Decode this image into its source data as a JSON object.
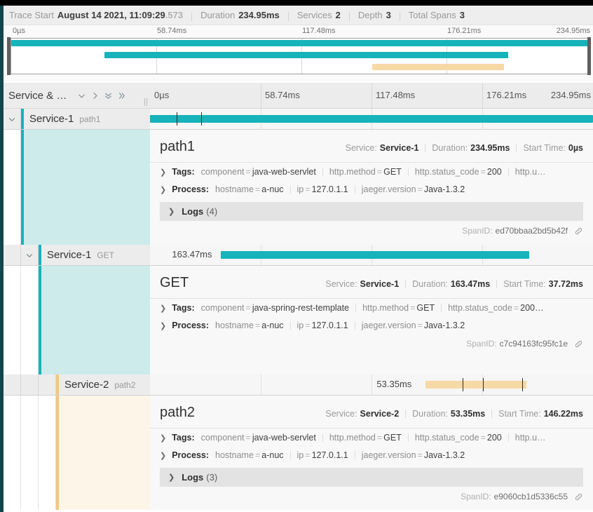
{
  "header": {
    "trace_start_label": "Trace Start",
    "trace_start_value": "August 14 2021, 11:09:29",
    "trace_start_ms": ".573",
    "duration_label": "Duration",
    "duration_value": "234.95ms",
    "services_label": "Services",
    "services_value": "2",
    "depth_label": "Depth",
    "depth_value": "3",
    "total_spans_label": "Total Spans",
    "total_spans_value": "3"
  },
  "minimap": {
    "ticks": [
      "0µs",
      "58.74ms",
      "117.48ms",
      "176.21ms",
      "234.95ms"
    ]
  },
  "timeline_header": {
    "column_title": "Service & …",
    "ticks": [
      "0µs",
      "58.74ms",
      "117.48ms",
      "176.21ms",
      "234.95ms"
    ],
    "icons": [
      "chevron-down-icon",
      "chevron-right-icon",
      "chevrons-down-icon",
      "chevrons-right-icon"
    ]
  },
  "colors": {
    "teal": "#17b3ba",
    "teal_dark": "#12464c",
    "orange": "#f7d9a6",
    "orange_accent": "#f3c77e",
    "tint_teal": "#cdebeb",
    "tint_orange": "#fdf5e7"
  },
  "spans": [
    {
      "service": "Service-1",
      "operation": "path1",
      "depth": 0,
      "color": "teal",
      "bar_label": "",
      "bar_start_pct": 0.0,
      "bar_width_pct": 100.0,
      "bar_ticks_pct": [
        6.0,
        11.5
      ],
      "detail": {
        "title": "path1",
        "service_label": "Service:",
        "service_value": "Service-1",
        "duration_label": "Duration:",
        "duration_value": "234.95ms",
        "start_label": "Start Time:",
        "start_value": "0µs",
        "tags_label": "Tags:",
        "tags": [
          {
            "k": "component",
            "v": "java-web-servlet"
          },
          {
            "k": "http.method",
            "v": "GET"
          },
          {
            "k": "http.status_code",
            "v": "200"
          },
          {
            "k": "http.u…",
            "v": ""
          }
        ],
        "process_label": "Process:",
        "process": [
          {
            "k": "hostname",
            "v": "a-nuc"
          },
          {
            "k": "ip",
            "v": "127.0.1.1"
          },
          {
            "k": "jaeger.version",
            "v": "Java-1.3.2"
          }
        ],
        "logs_label": "Logs",
        "logs_count": "(4)",
        "spanid_label": "SpanID:",
        "spanid_value": "ed70bbaa2bd5b42f"
      }
    },
    {
      "service": "Service-1",
      "operation": "GET",
      "depth": 1,
      "color": "teal",
      "bar_label": "163.47ms",
      "bar_start_pct": 16.05,
      "bar_width_pct": 69.6,
      "bar_ticks_pct": [],
      "detail": {
        "title": "GET",
        "service_label": "Service:",
        "service_value": "Service-1",
        "duration_label": "Duration:",
        "duration_value": "163.47ms",
        "start_label": "Start Time:",
        "start_value": "37.72ms",
        "tags_label": "Tags:",
        "tags": [
          {
            "k": "component",
            "v": "java-spring-rest-template"
          },
          {
            "k": "http.method",
            "v": "GET"
          },
          {
            "k": "http.status_code",
            "v": "200…"
          }
        ],
        "process_label": "Process:",
        "process": [
          {
            "k": "hostname",
            "v": "a-nuc"
          },
          {
            "k": "ip",
            "v": "127.0.1.1"
          },
          {
            "k": "jaeger.version",
            "v": "Java-1.3.2"
          }
        ],
        "logs_label": "",
        "logs_count": "",
        "spanid_label": "SpanID:",
        "spanid_value": "c7c94163fc95fc1e"
      }
    },
    {
      "service": "Service-2",
      "operation": "path2",
      "depth": 2,
      "color": "orange",
      "bar_label": "53.35ms",
      "bar_start_pct": 62.25,
      "bar_width_pct": 22.7,
      "bar_ticks_pct": [
        70.5,
        75.2,
        84.0
      ],
      "detail": {
        "title": "path2",
        "service_label": "Service:",
        "service_value": "Service-2",
        "duration_label": "Duration:",
        "duration_value": "53.35ms",
        "start_label": "Start Time:",
        "start_value": "146.22ms",
        "tags_label": "Tags:",
        "tags": [
          {
            "k": "component",
            "v": "java-web-servlet"
          },
          {
            "k": "http.method",
            "v": "GET"
          },
          {
            "k": "http.status_code",
            "v": "200"
          },
          {
            "k": "http.u…",
            "v": ""
          }
        ],
        "process_label": "Process:",
        "process": [
          {
            "k": "hostname",
            "v": "a-nuc"
          },
          {
            "k": "ip",
            "v": "127.0.1.1"
          },
          {
            "k": "jaeger.version",
            "v": "Java-1.3.2"
          }
        ],
        "logs_label": "Logs",
        "logs_count": "(3)",
        "spanid_label": "SpanID:",
        "spanid_value": "e9060cb1d5336c55"
      }
    }
  ],
  "minimap_bars": [
    {
      "color": "teal",
      "start_pct": 0.0,
      "width_pct": 100.0,
      "row": 0
    },
    {
      "color": "teal",
      "start_pct": 16.05,
      "width_pct": 69.6,
      "row": 1
    },
    {
      "color": "orange",
      "start_pct": 62.25,
      "width_pct": 22.7,
      "row": 2
    }
  ]
}
